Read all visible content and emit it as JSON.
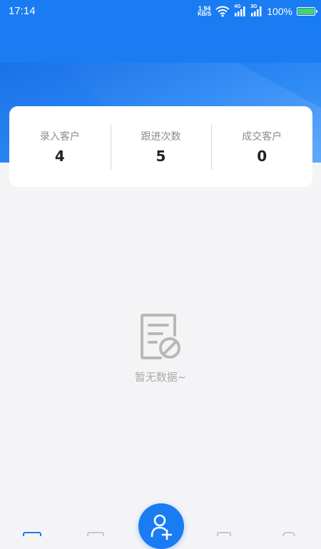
{
  "status_bar": {
    "time": "17:14",
    "net_speed_value": "1.94",
    "net_speed_unit": "KB/S",
    "signal_1_label": "4G",
    "signal_2_label": "3G",
    "battery_percent": "100%",
    "battery_level": 1.0
  },
  "stats": [
    {
      "label": "录入客户",
      "value": "4"
    },
    {
      "label": "跟进次数",
      "value": "5"
    },
    {
      "label": "成交客户",
      "value": "0"
    }
  ],
  "empty_state": {
    "icon": "no-data-document-icon",
    "text": "暂无数据~"
  },
  "bottom_nav": {
    "fab_icon": "add-user-icon"
  },
  "colors": {
    "primary": "#1a7cf2",
    "background": "#f4f4f6",
    "card": "#ffffff"
  }
}
